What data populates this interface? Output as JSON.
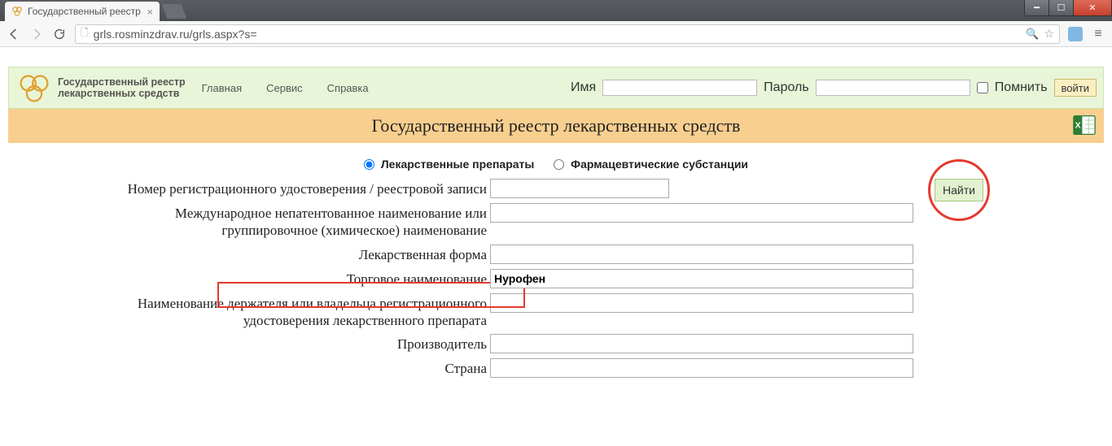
{
  "browser": {
    "tab_title": "Государственный реестр",
    "url": "grls.rosminzdrav.ru/grls.aspx?s="
  },
  "header": {
    "brand_line1": "Государственный реестр",
    "brand_line2": "лекарственных средств",
    "nav": {
      "home": "Главная",
      "service": "Сервис",
      "help": "Справка"
    },
    "login": {
      "name_label": "Имя",
      "pass_label": "Пароль",
      "remember": "Помнить",
      "submit": "войти"
    }
  },
  "band_title": "Государственный реестр лекарственных средств",
  "radios": {
    "drugs": "Лекарственные препараты",
    "substances": "Фармацевтические субстанции"
  },
  "form": {
    "labels": {
      "reg_number": "Номер регистрационного удостоверения / реестровой записи",
      "inn": "Международное непатентованное наименование или группировочное (химическое) наименование",
      "dosage_form": "Лекарственная форма",
      "trade_name": "Торговое наименование",
      "holder": "Наименование держателя или владельца регистрационного удостоверения лекарственного препарата",
      "manufacturer": "Производитель",
      "country": "Страна"
    },
    "values": {
      "reg_number": "",
      "inn": "",
      "dosage_form": "",
      "trade_name": "Нурофен",
      "holder": "",
      "manufacturer": "",
      "country": ""
    },
    "find": "Найти"
  }
}
